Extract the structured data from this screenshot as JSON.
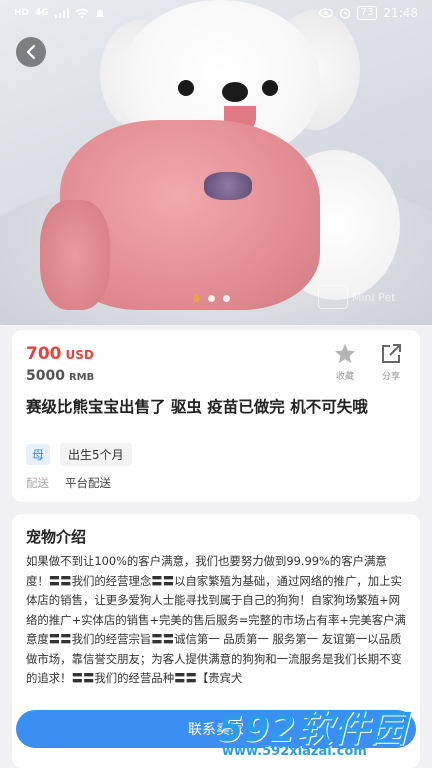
{
  "status_bar": {
    "time": "21:48",
    "battery": "73",
    "signal_1": "4G",
    "signal_2": "HD"
  },
  "hero": {
    "watermark_text": "Mini Pet",
    "slide_count": 3,
    "active_slide": 1
  },
  "listing": {
    "price_usd": "700",
    "usd_label": "USD",
    "price_rmb": "5000",
    "rmb_label": "RMB",
    "favorite_label": "收藏",
    "share_label": "分享",
    "title": "赛级比熊宝宝出售了 驱虫 疫苗已做完 机不可失哦",
    "gender_tag": "母",
    "age_tag": "出生5个月",
    "delivery_key": "配送",
    "delivery_value": "平台配送"
  },
  "intro": {
    "heading": "宠物介绍",
    "text": "如果做不到让100%的客户满意，我们也要努力做到99.99%的客户满意度！〓〓我们的经营理念〓〓以自家繁殖为基础，通过网络的推广，加上实体店的销售，让更多爱狗人士能寻找到属于自己的狗狗！自家狗场繁殖+网络的推广+实体店的销售+完美的售后服务=完整的市场占有率+完美客户满意度〓〓我们的经营宗旨〓〓诚信第一 品质第一 服务第一 友谊第一以品质做市场，靠信誉交朋友；为客人提供满意的狗狗和一流服务是我们长期不变的追求！〓〓我们的经营品种〓〓【贵宾犬"
  },
  "contact": {
    "label": "联系卖家"
  },
  "site_watermark": {
    "name": "592软件园",
    "url": "www.592xiazai.com"
  },
  "colors": {
    "price_red": "#e8443a",
    "accent_blue": "#3b8ff0",
    "active_dot": "#f0a43c"
  }
}
